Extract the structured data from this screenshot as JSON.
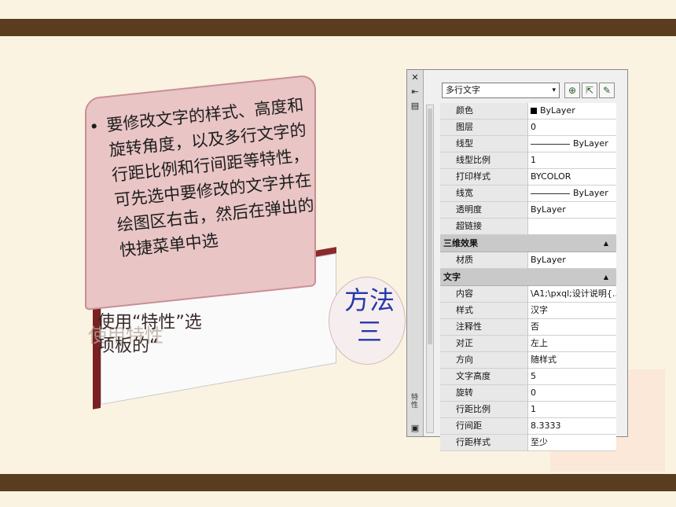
{
  "slide": {
    "bullet": "•",
    "main_text": "要修改文字的样式、高度和旋转角度，以及多行文字的行距比例和行间距等特性，可先选中要修改的文字并在绘图区右击，然后在弹出的快捷菜单中选",
    "back_line1": "使用“特性”选",
    "back_line2": "项板的“",
    "ghost_text": "使用特性",
    "method_line1": "方法",
    "method_line2": "三"
  },
  "palette": {
    "strip_icons": {
      "close": "✕",
      "autohide": "⇤",
      "properties_menu": "▤",
      "bottom": "▣"
    },
    "vertical_label": "特性",
    "object_select": "多行文字",
    "object_select_arrow": "▾",
    "toolbar": {
      "toggle_pickadd": "⊕",
      "select_objects": "⇱",
      "quick_select": "✎"
    },
    "rows_general": [
      {
        "k": "颜色",
        "v": "ByLayer",
        "mark": "swatch"
      },
      {
        "k": "图层",
        "v": "0"
      },
      {
        "k": "线型",
        "v": "ByLayer",
        "mark": "line"
      },
      {
        "k": "线型比例",
        "v": "1"
      },
      {
        "k": "打印样式",
        "v": "BYCOLOR"
      },
      {
        "k": "线宽",
        "v": "ByLayer",
        "mark": "line"
      },
      {
        "k": "透明度",
        "v": "ByLayer"
      },
      {
        "k": "超链接",
        "v": ""
      }
    ],
    "section_3d": "三维效果",
    "rows_3d": [
      {
        "k": "材质",
        "v": "ByLayer"
      }
    ],
    "section_text": "文字",
    "section_caret": "▲",
    "rows_text": [
      {
        "k": "内容",
        "v": "\\A1;\\pxql;设计说明{..."
      },
      {
        "k": "样式",
        "v": "汉字"
      },
      {
        "k": "注释性",
        "v": "否"
      },
      {
        "k": "对正",
        "v": "左上"
      },
      {
        "k": "方向",
        "v": "随样式"
      },
      {
        "k": "文字高度",
        "v": "5"
      },
      {
        "k": "旋转",
        "v": "0"
      },
      {
        "k": "行距比例",
        "v": "1"
      },
      {
        "k": "行间距",
        "v": "8.3333"
      },
      {
        "k": "行距样式",
        "v": "至少"
      }
    ]
  }
}
